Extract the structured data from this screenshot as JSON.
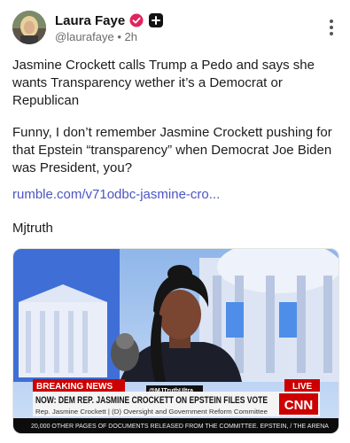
{
  "post": {
    "author": {
      "name": "Laura Faye",
      "handle": "@laurafaye",
      "separator": "•",
      "time": "2h"
    },
    "paragraphs": {
      "p1": "Jasmine Crockett calls Trump a Pedo and says she wants Transparency wether it’s a Democrat or Republican",
      "p2": "Funny, I don’t remember Jasmine Crockett pushing for that Epstein “transparency” when Democrat Joe Biden was President, you?",
      "link": "rumble.com/v71odbc-jasmine-cro...",
      "sign": "Mjtruth"
    },
    "media": {
      "breaking_label": "BREAKING NEWS",
      "live_label": "LIVE",
      "watermark": "@MJTruthUltra",
      "headline": "NOW: DEM REP. JASMINE CROCKETT ON EPSTEIN FILES VOTE",
      "subline": "Rep. Jasmine Crockett  |  (D) Oversight and Government Reform Committee",
      "ticker": "20,000 OTHER PAGES OF DOCUMENTS RELEASED FROM THE COMMITTEE. EPSTEIN, / THE ARENA",
      "network_logo": "CNN"
    }
  },
  "colors": {
    "accent_link": "#4a55c2",
    "verified_badge": "#e0245e",
    "breaking_red": "#cc0000"
  },
  "icons": {
    "verified": "verified-badge-icon",
    "plus": "plus-icon",
    "more": "vertical-ellipsis-icon"
  }
}
